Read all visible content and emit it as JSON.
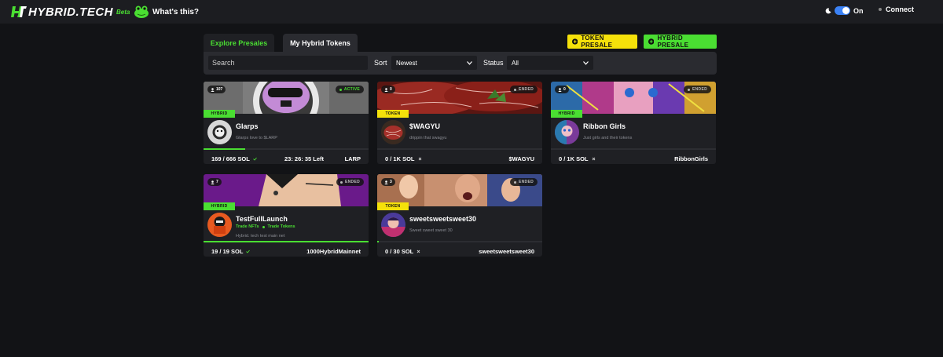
{
  "header": {
    "logo_text": "HYBRID.TECH",
    "beta_label": "Beta",
    "whats_this": "What's this?",
    "theme_label": "On",
    "connect_label": "Connect"
  },
  "tabs": [
    {
      "label": "Explore Presales",
      "active": true
    },
    {
      "label": "My Hybrid Tokens",
      "active": false
    }
  ],
  "actions": {
    "token_presale": "TOKEN PRESALE",
    "hybrid_presale": "HYBRID PRESALE"
  },
  "filters": {
    "search_placeholder": "Search",
    "sort_label": "Sort",
    "sort_value": "Newest",
    "status_label": "Status",
    "status_value": "All"
  },
  "colors": {
    "accent_green": "#4ade32",
    "accent_yellow": "#f5e10a",
    "background": "#121316",
    "card": "#1f2024"
  },
  "cards": [
    {
      "count": "107",
      "status": "ACTIVE",
      "type": "HYBRID",
      "title": "Glarps",
      "links": [],
      "description": "Glarps love to $LARP",
      "raise": "169 / 666 SOL",
      "raise_mark": "check-icon",
      "time_left": "23: 26: 35 Left",
      "ticker": "LARP",
      "progress": 0.25
    },
    {
      "count": "0",
      "status": "ENDED",
      "type": "TOKEN",
      "title": "$WAGYU",
      "links": [],
      "description": "drippin that swagyu",
      "raise": "0 / 1K SOL",
      "raise_mark": "x-icon",
      "time_left": "",
      "ticker": "$WAGYU",
      "progress": 0
    },
    {
      "count": "0",
      "status": "ENDED",
      "type": "HYBRID",
      "title": "Ribbon Girls",
      "links": [],
      "description": "Just girls and their tokens",
      "raise": "0 / 1K SOL",
      "raise_mark": "x-icon",
      "time_left": "",
      "ticker": "RibbonGirls",
      "progress": 0
    },
    {
      "count": "7",
      "status": "ENDED",
      "type": "HYBRID",
      "title": "TestFullLaunch",
      "links": [
        "Trade NFTs",
        "Trade Tokens"
      ],
      "description": "Hybrid. tech test main net",
      "raise": "19 / 19 SOL",
      "raise_mark": "check-icon",
      "time_left": "",
      "ticker": "1000HybridMainnet",
      "progress": 1.0
    },
    {
      "count": "3",
      "status": "ENDED",
      "type": "TOKEN",
      "title": "sweetsweetsweet30",
      "links": [],
      "description": "Sweet sweet sweet 30",
      "raise": "0 / 30 SOL",
      "raise_mark": "x-icon",
      "time_left": "",
      "ticker": "sweetsweetsweet30",
      "progress": 0.01
    }
  ]
}
